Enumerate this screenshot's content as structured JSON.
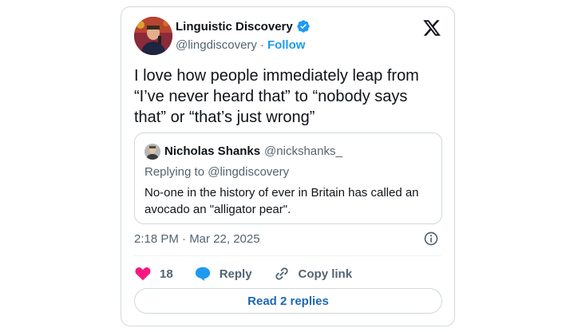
{
  "author": {
    "display_name": "Linguistic Discovery",
    "handle": "@lingdiscovery",
    "separator": "·",
    "follow_label": "Follow",
    "verified": true
  },
  "tweet": {
    "text": "I love how people immediately leap from “I’ve never heard that” to “nobody says that” or “that’s just wrong”",
    "timestamp": "2:18 PM · Mar 22, 2025"
  },
  "quoted_tweet": {
    "display_name": "Nicholas Shanks",
    "handle": "@nickshanks_",
    "replying_to": "Replying to @lingdiscovery",
    "text": "No-one in the history of ever in Britain has called an avocado an \"alligator pear\"."
  },
  "actions": {
    "likes_count": "18",
    "reply_label": "Reply",
    "copy_link_label": "Copy link"
  },
  "footer": {
    "read_replies_label": "Read 2 replies"
  },
  "colors": {
    "accent": "#1d9bf0",
    "like": "#f91880",
    "text": "#0f1419",
    "muted": "#536471",
    "border": "#cfd9de"
  },
  "icons": {
    "verified": "verified-badge-icon",
    "platform": "x-logo-icon",
    "info": "info-icon",
    "like": "heart-icon",
    "reply": "speech-bubble-icon",
    "copy_link": "link-icon"
  }
}
